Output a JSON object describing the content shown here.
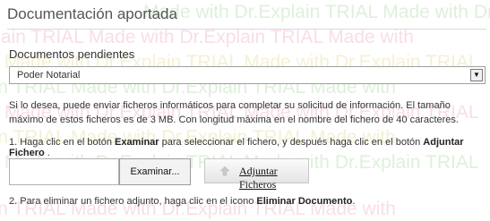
{
  "section": {
    "title": "Documentación aportada"
  },
  "watermark": {
    "lines": [
      "Made with Dr.Explain TRIAL  Made with Dr.Explain TRIAL",
      "Explain TRIAL  Made with Dr.Explain TRIAL  Made with",
      "Made with Dr.Explain TRIAL  Made with Dr.Explain TRIAL",
      "Explain TRIAL  Made with Dr.Explain TRIAL  Made with",
      "Made with Dr.Explain TRIAL  Made with Dr.Explain TRIAL",
      "Explain TRIAL  Made with Dr.Explain TRIAL  Made with",
      "Made with Dr.Explain TRIAL  Made with Dr.Explain TRIAL",
      "Explain TRIAL  Made with Dr.Explain TRIAL  Made with"
    ]
  },
  "pending": {
    "label": "Documentos pendientes",
    "selected": "Poder Notarial"
  },
  "info": {
    "text": "Si lo desea, puede enviar ficheros informáticos para completar su solicitud de información. El tamaño máximo de estos ficheros es de 3 MB. Con longitud máxima en el nombre del fichero de 40 caracteres."
  },
  "step1": {
    "prefix": "1. Haga clic en el botón ",
    "examinar": "Examinar",
    "middle": " para seleccionar el fichero, y después haga clic en el botón ",
    "adjuntar": "Adjuntar Fichero",
    "suffix": " ."
  },
  "upload": {
    "browse_label": "Examinar...",
    "attach_label": "Adjuntar Ficheros"
  },
  "step2": {
    "prefix": "2. Para eliminar un fichero adjunto, haga clic en el icono ",
    "eliminar": "Eliminar Documento",
    "suffix": "."
  },
  "colors": {
    "title": "#555555",
    "text": "#333333",
    "watermark_green": "#b8e0b0",
    "watermark_pink": "#f0b8c8",
    "watermark_yellow": "#e8e0a0"
  }
}
